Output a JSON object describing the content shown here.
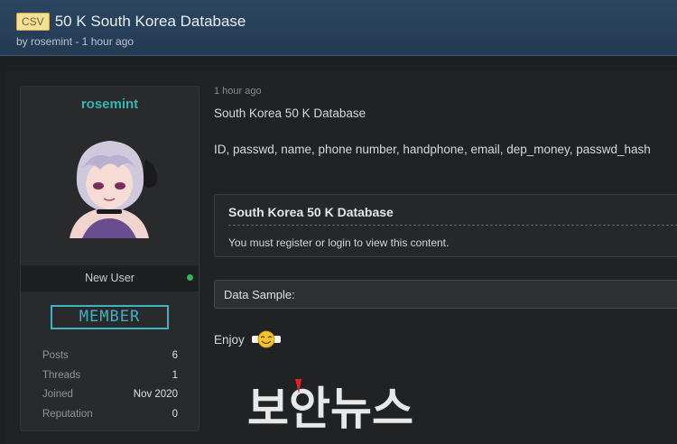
{
  "thread": {
    "prefix": "CSV",
    "title": "50 K South Korea Database",
    "byline": "by rosemint - 1 hour ago"
  },
  "user": {
    "name": "rosemint",
    "title": "New User",
    "badge": "MEMBER",
    "status_color": "#36b35a",
    "stats": [
      {
        "label": "Posts",
        "value": "6"
      },
      {
        "label": "Threads",
        "value": "1"
      },
      {
        "label": "Joined",
        "value": "Nov 2020"
      },
      {
        "label": "Reputation",
        "value": "0"
      }
    ]
  },
  "post": {
    "date": "1 hour ago",
    "line1": "South Korea 50 K Database",
    "line2": "ID, passwd, name, phone number, handphone, email, dep_money, passwd_hash",
    "hidden_title": "South Korea 50 K Database",
    "hidden_text": "You must register or login to view this content.",
    "spoiler_label": "Data Sample:",
    "enjoy": "Enjoy"
  },
  "watermark": {
    "text": "보안뉴스",
    "color": "#e8e8e8",
    "accent": "#d8242a"
  },
  "colors": {
    "accent": "#3bb3b0",
    "header": "#2c4661"
  }
}
